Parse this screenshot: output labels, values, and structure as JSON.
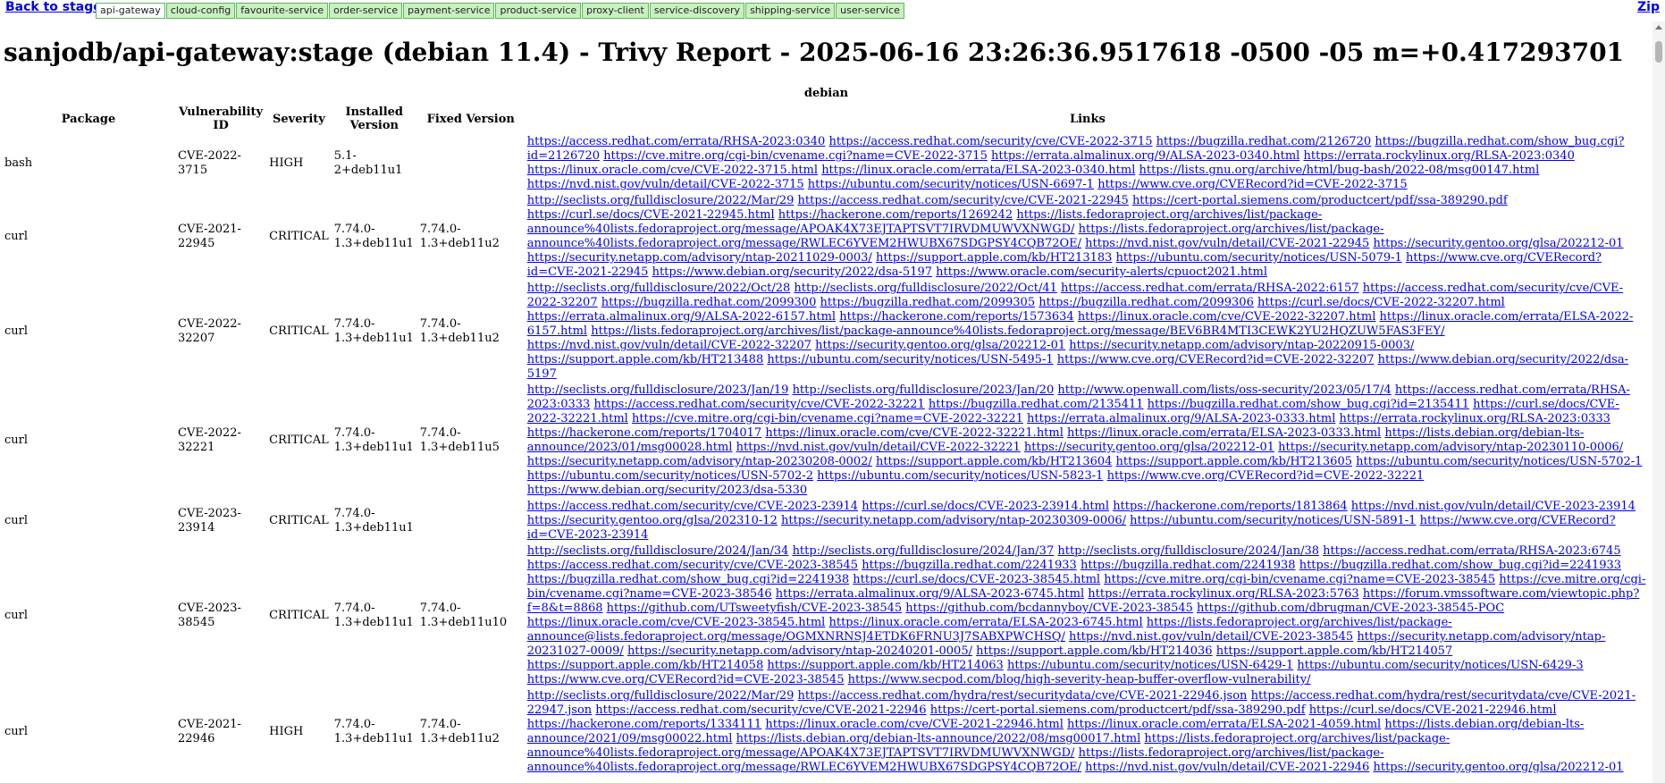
{
  "nav": {
    "back_label": "Back to stage",
    "zip_label": "Zip",
    "tabs": [
      {
        "label": "api-gateway"
      },
      {
        "label": "cloud-config"
      },
      {
        "label": "favourite-service"
      },
      {
        "label": "order-service"
      },
      {
        "label": "payment-service"
      },
      {
        "label": "product-service"
      },
      {
        "label": "proxy-client"
      },
      {
        "label": "service-discovery"
      },
      {
        "label": "shipping-service"
      },
      {
        "label": "user-service"
      }
    ],
    "active_tab": "api-gateway"
  },
  "page_title": "sanjodb/api-gateway:stage (debian 11.4) - Trivy Report - 2025-06-16 23:26:36.9517618 -0500 -05 m=+0.417293701",
  "table": {
    "caption": "debian",
    "headers": {
      "package": "Package",
      "vuln_id": "Vulnerability ID",
      "severity": "Severity",
      "installed": "Installed Version",
      "fixed": "Fixed Version",
      "links": "Links"
    },
    "rows": [
      {
        "package": "bash",
        "id": "CVE-2022-3715",
        "severity": "HIGH",
        "installed": "5.1-2+deb11u1",
        "fixed": "",
        "links": [
          "https://access.redhat.com/errata/RHSA-2023:0340",
          "https://access.redhat.com/security/cve/CVE-2022-3715",
          "https://bugzilla.redhat.com/2126720",
          "https://bugzilla.redhat.com/show_bug.cgi?id=2126720",
          "https://cve.mitre.org/cgi-bin/cvename.cgi?name=CVE-2022-3715",
          "https://errata.almalinux.org/9/ALSA-2023-0340.html",
          "https://errata.rockylinux.org/RLSA-2023:0340",
          "https://linux.oracle.com/cve/CVE-2022-3715.html",
          "https://linux.oracle.com/errata/ELSA-2023-0340.html",
          "https://lists.gnu.org/archive/html/bug-bash/2022-08/msg00147.html",
          "https://nvd.nist.gov/vuln/detail/CVE-2022-3715",
          "https://ubuntu.com/security/notices/USN-6697-1",
          "https://www.cve.org/CVERecord?id=CVE-2022-3715"
        ]
      },
      {
        "package": "curl",
        "id": "CVE-2021-22945",
        "severity": "CRITICAL",
        "installed": "7.74.0-1.3+deb11u1",
        "fixed": "7.74.0-1.3+deb11u2",
        "links": [
          "http://seclists.org/fulldisclosure/2022/Mar/29",
          "https://access.redhat.com/security/cve/CVE-2021-22945",
          "https://cert-portal.siemens.com/productcert/pdf/ssa-389290.pdf",
          "https://curl.se/docs/CVE-2021-22945.html",
          "https://hackerone.com/reports/1269242",
          "https://lists.fedoraproject.org/archives/list/package-announce%40lists.fedoraproject.org/message/APOAK4X73EJTAPTSVT7IRVDMUWVXNWGD/",
          "https://lists.fedoraproject.org/archives/list/package-announce%40lists.fedoraproject.org/message/RWLEC6YVEM2HWUBX67SDGPSY4CQB72OE/",
          "https://nvd.nist.gov/vuln/detail/CVE-2021-22945",
          "https://security.gentoo.org/glsa/202212-01",
          "https://security.netapp.com/advisory/ntap-20211029-0003/",
          "https://support.apple.com/kb/HT213183",
          "https://ubuntu.com/security/notices/USN-5079-1",
          "https://www.cve.org/CVERecord?id=CVE-2021-22945",
          "https://www.debian.org/security/2022/dsa-5197",
          "https://www.oracle.com/security-alerts/cpuoct2021.html"
        ]
      },
      {
        "package": "curl",
        "id": "CVE-2022-32207",
        "severity": "CRITICAL",
        "installed": "7.74.0-1.3+deb11u1",
        "fixed": "7.74.0-1.3+deb11u2",
        "links": [
          "http://seclists.org/fulldisclosure/2022/Oct/28",
          "http://seclists.org/fulldisclosure/2022/Oct/41",
          "https://access.redhat.com/errata/RHSA-2022:6157",
          "https://access.redhat.com/security/cve/CVE-2022-32207",
          "https://bugzilla.redhat.com/2099300",
          "https://bugzilla.redhat.com/2099305",
          "https://bugzilla.redhat.com/2099306",
          "https://curl.se/docs/CVE-2022-32207.html",
          "https://errata.almalinux.org/9/ALSA-2022-6157.html",
          "https://hackerone.com/reports/1573634",
          "https://linux.oracle.com/cve/CVE-2022-32207.html",
          "https://linux.oracle.com/errata/ELSA-2022-6157.html",
          "https://lists.fedoraproject.org/archives/list/package-announce%40lists.fedoraproject.org/message/BEV6BR4MTI3CEWK2YU2HQZUW5FAS3FEY/",
          "https://nvd.nist.gov/vuln/detail/CVE-2022-32207",
          "https://security.gentoo.org/glsa/202212-01",
          "https://security.netapp.com/advisory/ntap-20220915-0003/",
          "https://support.apple.com/kb/HT213488",
          "https://ubuntu.com/security/notices/USN-5495-1",
          "https://www.cve.org/CVERecord?id=CVE-2022-32207",
          "https://www.debian.org/security/2022/dsa-5197"
        ]
      },
      {
        "package": "curl",
        "id": "CVE-2022-32221",
        "severity": "CRITICAL",
        "installed": "7.74.0-1.3+deb11u1",
        "fixed": "7.74.0-1.3+deb11u5",
        "links": [
          "http://seclists.org/fulldisclosure/2023/Jan/19",
          "http://seclists.org/fulldisclosure/2023/Jan/20",
          "http://www.openwall.com/lists/oss-security/2023/05/17/4",
          "https://access.redhat.com/errata/RHSA-2023:0333",
          "https://access.redhat.com/security/cve/CVE-2022-32221",
          "https://bugzilla.redhat.com/2135411",
          "https://bugzilla.redhat.com/show_bug.cgi?id=2135411",
          "https://curl.se/docs/CVE-2022-32221.html",
          "https://cve.mitre.org/cgi-bin/cvename.cgi?name=CVE-2022-32221",
          "https://errata.almalinux.org/9/ALSA-2023-0333.html",
          "https://errata.rockylinux.org/RLSA-2023:0333",
          "https://hackerone.com/reports/1704017",
          "https://linux.oracle.com/cve/CVE-2022-32221.html",
          "https://linux.oracle.com/errata/ELSA-2023-0333.html",
          "https://lists.debian.org/debian-lts-announce/2023/01/msg00028.html",
          "https://nvd.nist.gov/vuln/detail/CVE-2022-32221",
          "https://security.gentoo.org/glsa/202212-01",
          "https://security.netapp.com/advisory/ntap-20230110-0006/",
          "https://security.netapp.com/advisory/ntap-20230208-0002/",
          "https://support.apple.com/kb/HT213604",
          "https://support.apple.com/kb/HT213605",
          "https://ubuntu.com/security/notices/USN-5702-1",
          "https://ubuntu.com/security/notices/USN-5702-2",
          "https://ubuntu.com/security/notices/USN-5823-1",
          "https://www.cve.org/CVERecord?id=CVE-2022-32221",
          "https://www.debian.org/security/2023/dsa-5330"
        ]
      },
      {
        "package": "curl",
        "id": "CVE-2023-23914",
        "severity": "CRITICAL",
        "installed": "7.74.0-1.3+deb11u1",
        "fixed": "",
        "links": [
          "https://access.redhat.com/security/cve/CVE-2023-23914",
          "https://curl.se/docs/CVE-2023-23914.html",
          "https://hackerone.com/reports/1813864",
          "https://nvd.nist.gov/vuln/detail/CVE-2023-23914",
          "https://security.gentoo.org/glsa/202310-12",
          "https://security.netapp.com/advisory/ntap-20230309-0006/",
          "https://ubuntu.com/security/notices/USN-5891-1",
          "https://www.cve.org/CVERecord?id=CVE-2023-23914"
        ]
      },
      {
        "package": "curl",
        "id": "CVE-2023-38545",
        "severity": "CRITICAL",
        "installed": "7.74.0-1.3+deb11u1",
        "fixed": "7.74.0-1.3+deb11u10",
        "links": [
          "http://seclists.org/fulldisclosure/2024/Jan/34",
          "http://seclists.org/fulldisclosure/2024/Jan/37",
          "http://seclists.org/fulldisclosure/2024/Jan/38",
          "https://access.redhat.com/errata/RHSA-2023:6745",
          "https://access.redhat.com/security/cve/CVE-2023-38545",
          "https://bugzilla.redhat.com/2241933",
          "https://bugzilla.redhat.com/2241938",
          "https://bugzilla.redhat.com/show_bug.cgi?id=2241933",
          "https://bugzilla.redhat.com/show_bug.cgi?id=2241938",
          "https://curl.se/docs/CVE-2023-38545.html",
          "https://cve.mitre.org/cgi-bin/cvename.cgi?name=CVE-2023-38545",
          "https://cve.mitre.org/cgi-bin/cvename.cgi?name=CVE-2023-38546",
          "https://errata.almalinux.org/9/ALSA-2023-6745.html",
          "https://errata.rockylinux.org/RLSA-2023:5763",
          "https://forum.vmssoftware.com/viewtopic.php?f=8&t=8868",
          "https://github.com/UTsweetyfish/CVE-2023-38545",
          "https://github.com/bcdannyboy/CVE-2023-38545",
          "https://github.com/dbrugman/CVE-2023-38545-POC",
          "https://linux.oracle.com/cve/CVE-2023-38545.html",
          "https://linux.oracle.com/errata/ELSA-2023-6745.html",
          "https://lists.fedoraproject.org/archives/list/package-announce@lists.fedoraproject.org/message/OGMXNRNSJ4ETDK6FRNU3J7SABXPWCHSQ/",
          "https://nvd.nist.gov/vuln/detail/CVE-2023-38545",
          "https://security.netapp.com/advisory/ntap-20231027-0009/",
          "https://security.netapp.com/advisory/ntap-20240201-0005/",
          "https://support.apple.com/kb/HT214036",
          "https://support.apple.com/kb/HT214057",
          "https://support.apple.com/kb/HT214058",
          "https://support.apple.com/kb/HT214063",
          "https://ubuntu.com/security/notices/USN-6429-1",
          "https://ubuntu.com/security/notices/USN-6429-3",
          "https://www.cve.org/CVERecord?id=CVE-2023-38545",
          "https://www.secpod.com/blog/high-severity-heap-buffer-overflow-vulnerability/"
        ]
      },
      {
        "package": "curl",
        "id": "CVE-2021-22946",
        "severity": "HIGH",
        "installed": "7.74.0-1.3+deb11u1",
        "fixed": "7.74.0-1.3+deb11u2",
        "links": [
          "http://seclists.org/fulldisclosure/2022/Mar/29",
          "https://access.redhat.com/hydra/rest/securitydata/cve/CVE-2021-22946.json",
          "https://access.redhat.com/hydra/rest/securitydata/cve/CVE-2021-22947.json",
          "https://access.redhat.com/security/cve/CVE-2021-22946",
          "https://cert-portal.siemens.com/productcert/pdf/ssa-389290.pdf",
          "https://curl.se/docs/CVE-2021-22946.html",
          "https://hackerone.com/reports/1334111",
          "https://linux.oracle.com/cve/CVE-2021-22946.html",
          "https://linux.oracle.com/errata/ELSA-2021-4059.html",
          "https://lists.debian.org/debian-lts-announce/2021/09/msg00022.html",
          "https://lists.debian.org/debian-lts-announce/2022/08/msg00017.html",
          "https://lists.fedoraproject.org/archives/list/package-announce%40lists.fedoraproject.org/message/APOAK4X73EJTAPTSVT7IRVDMUWVXNWGD/",
          "https://lists.fedoraproject.org/archives/list/package-announce%40lists.fedoraproject.org/message/RWLEC6YVEM2HWUBX67SDGPSY4CQB72OE/",
          "https://nvd.nist.gov/vuln/detail/CVE-2021-22946",
          "https://security.gentoo.org/glsa/202212-01"
        ]
      }
    ]
  },
  "colors": {
    "link": "#0000ee",
    "tab_bg": "#c8f0c0",
    "tab_border": "#5cb85c"
  }
}
